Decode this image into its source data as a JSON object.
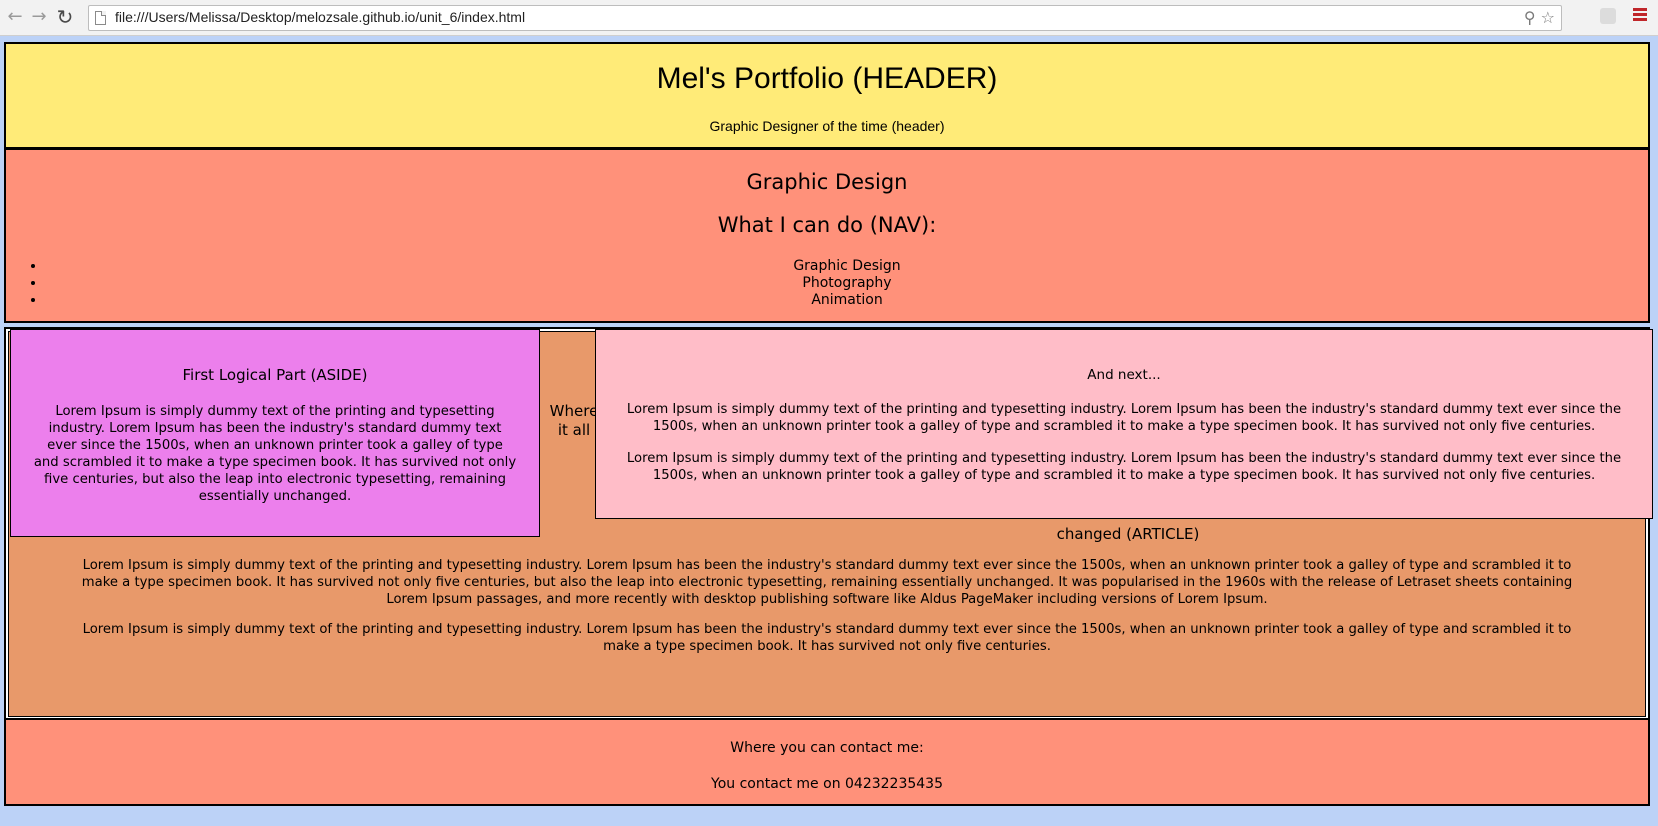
{
  "browser": {
    "back_icon": "arrow-left-icon",
    "forward_icon": "arrow-right-icon",
    "reload_icon": "reload-icon",
    "url": "file:///Users/Melissa/Desktop/melozsale.github.io/unit_6/index.html"
  },
  "header": {
    "title": "Mel's Portfolio (HEADER)",
    "subtitle": "Graphic Designer of the time (header)"
  },
  "nav": {
    "heading": "Graphic Design",
    "subheading": "What I can do (NAV):",
    "items": [
      "Graphic Design",
      "Photography",
      "Animation"
    ]
  },
  "aside": {
    "title": "First Logical Part (ASIDE)",
    "text": "Lorem Ipsum is simply dummy text of the printing and typesetting industry. Lorem Ipsum has been the industry's standard dummy text ever since the 1500s, when an unknown printer took a galley of type and scrambled it to make a type specimen book. It has survived not only five centuries, but also the leap into electronic typesetting, remaining essentially unchanged."
  },
  "article": {
    "heading_start": "Where it all",
    "heading_end": "changed (ARTICLE)",
    "paragraph1": "Lorem Ipsum is simply dummy text of the printing and typesetting industry. Lorem Ipsum has been the industry's standard dummy text ever since the 1500s, when an unknown printer took a galley of type and scrambled it to make a type specimen book. It has survived not only five centuries, but also the leap into electronic typesetting, remaining essentially unchanged. It was popularised in the 1960s with the release of Letraset sheets containing Lorem Ipsum passages, and more recently with desktop publishing software like Aldus PageMaker including versions of Lorem Ipsum.",
    "paragraph2": "Lorem Ipsum is simply dummy text of the printing and typesetting industry. Lorem Ipsum has been the industry's standard dummy text ever since the 1500s, when an unknown printer took a galley of type and scrambled it to make a type specimen book. It has survived not only five centuries."
  },
  "next_section": {
    "title": "And next...",
    "paragraph1": "Lorem Ipsum is simply dummy text of the printing and typesetting industry. Lorem Ipsum has been the industry's standard dummy text ever since the 1500s, when an unknown printer took a galley of type and scrambled it to make a type specimen book. It has survived not only five centuries.",
    "paragraph2": "Lorem Ipsum is simply dummy text of the printing and typesetting industry. Lorem Ipsum has been the industry's standard dummy text ever since the 1500s, when an unknown printer took a galley of type and scrambled it to make a type specimen book. It has survived not only five centuries."
  },
  "footer": {
    "line1": "Where you can contact me:",
    "line2": "You contact me on 04232235435"
  },
  "colors": {
    "header_bg": "#ffeb78",
    "nav_bg": "#ff917a",
    "aside_bg": "#ec7fec",
    "article_bg": "#e8996a",
    "next_bg": "#ffbdc8",
    "footer_bg": "#ff917a",
    "page_bg": "#bcd2f7"
  }
}
